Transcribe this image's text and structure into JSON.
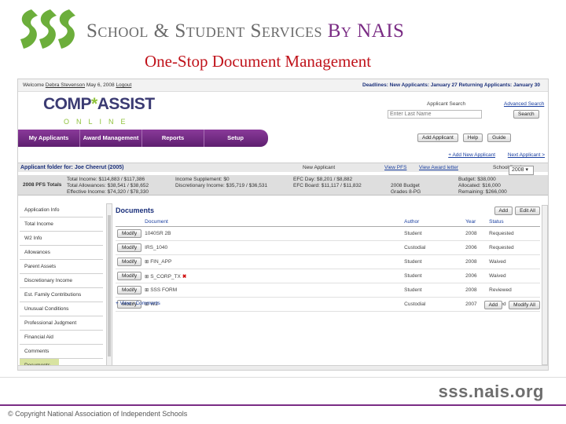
{
  "slide": {
    "brand_main": "School & Student Services",
    "brand_by": "By NAIS",
    "title": "One-Stop Document Management",
    "site": "sss.nais.org",
    "copyright": "© Copyright National Association of Independent Schools",
    "colors": {
      "green": "#6cae3b",
      "purple": "#7a2c84",
      "title_red": "#c0131b"
    }
  },
  "app": {
    "welcome_prefix": "Welcome",
    "welcome_user": "Debra Stevenson",
    "welcome_date": "May 6, 2008",
    "logout": "Logout",
    "deadlines": "Deadlines: New Applicants: January 27   Returning Applicants: January 30",
    "logo_main_1": "COMP",
    "logo_star": "*",
    "logo_main_2": "ASSIST",
    "logo_online": "ONLINE",
    "search_label": "Applicant Search",
    "search_placeholder": "Enter Last Name",
    "advanced_search": "Advanced Search",
    "search_button": "Search",
    "nav": [
      "My Applicants",
      "Award Management",
      "Reports",
      "Setup"
    ],
    "toolbar": [
      "Add Applicant",
      "Help",
      "Guide"
    ],
    "add_links": [
      "+ Add New Applicant",
      "Next Applicant >"
    ],
    "folder_title": "Applicant folder for: Joe Cheerut (2005)",
    "new_applicant": "New Applicant",
    "view_pfs": "View PFS",
    "view_award": "View Award letter",
    "fiscal_year_label": "School fiscal year",
    "fiscal_year": "2008",
    "summary": {
      "pfs_totals": "2008 PFS Totals",
      "total_income": "Total Income:  $114,883 / $117,386",
      "total_allowances": "Total Allowances:  $38,541 / $38,652",
      "effective_income": "Effective Income:  $74,320 / $78,330",
      "income_supplement": "Income Supplement:  $0",
      "discretionary_income": "Discretionary Income:  $35,719 / $36,531",
      "efc_day": "EFC Day:  $8,201 / $8,882",
      "efc_board": "EFC Board:  $11,117 / $11,832",
      "budget_line": "2008 Budget",
      "grades": "Grades 8-PG",
      "budget": "Budget:  $38,000",
      "allocated": "Allocated:  $16,000",
      "remaining": "Remaining:  $266,000"
    },
    "sidebar": [
      "Application Info",
      "Total Income",
      "W2 Info",
      "Allowances",
      "Parent Assets",
      "Discretionary Income",
      "Est. Family Contributions",
      "Unusual Conditions",
      "Professional Judgment",
      "Financial Aid",
      "Comments",
      "Documents"
    ],
    "documents_title": "Documents",
    "doc_buttons": [
      "Add",
      "Edit All"
    ],
    "columns": [
      "Document",
      "Author",
      "Year",
      "Status"
    ],
    "rows": [
      {
        "action": "Modify",
        "doc": "1040SR 2B",
        "author": "Student",
        "year": "2008",
        "status": "Requested"
      },
      {
        "action": "Modify",
        "doc": "IRS_1040",
        "author": "Custodial",
        "year": "2006",
        "status": "Requested"
      },
      {
        "action": "Modify",
        "doc": "FIN_APP",
        "author": "Student",
        "year": "2008",
        "status": "Waived"
      },
      {
        "action": "Modify",
        "doc": "S_CORP_TX",
        "author": "Student",
        "year": "2006",
        "status": "Waived"
      },
      {
        "action": "Modify",
        "doc": "SSS FORM",
        "author": "Student",
        "year": "2008",
        "status": "Reviewed"
      },
      {
        "action": "Modify",
        "doc": "W2",
        "author": "Custodial",
        "year": "2007",
        "status": "Waived"
      }
    ],
    "view_comments": "+ View - Comments",
    "foot_buttons": [
      "Add",
      "Modify All"
    ]
  }
}
